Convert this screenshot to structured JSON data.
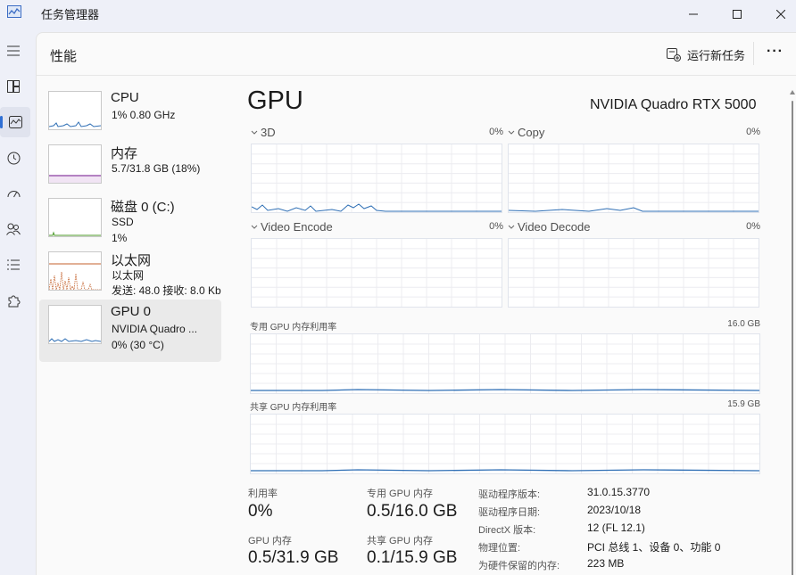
{
  "window": {
    "title": "任务管理器"
  },
  "header": {
    "page_title": "性能",
    "run_task_label": "运行新任务",
    "more_label": "···"
  },
  "resources": [
    {
      "name": "CPU",
      "line1": "1% 0.80 GHz",
      "line2": ""
    },
    {
      "name": "内存",
      "line1": "5.7/31.8 GB (18%)",
      "line2": ""
    },
    {
      "name": "磁盘 0 (C:)",
      "line1": "SSD",
      "line2": "1%"
    },
    {
      "name": "以太网",
      "line1": "以太网",
      "line2": "发送: 48.0  接收: 8.0 Kb"
    },
    {
      "name": "GPU 0",
      "line1": "NVIDIA Quadro ...",
      "line2": "0% (30 °C)"
    }
  ],
  "gpu": {
    "heading": "GPU",
    "model": "NVIDIA Quadro RTX 5000",
    "engines": [
      {
        "label": "3D",
        "pct": "0%"
      },
      {
        "label": "Copy",
        "pct": "0%"
      },
      {
        "label": "Video Encode",
        "pct": "0%"
      },
      {
        "label": "Video Decode",
        "pct": "0%"
      }
    ],
    "dedicated_label": "专用 GPU 内存利用率",
    "dedicated_max": "16.0 GB",
    "shared_label": "共享 GPU 内存利用率",
    "shared_max": "15.9 GB",
    "stats": {
      "utilization_label": "利用率",
      "utilization_value": "0%",
      "dedicated_mem_label": "专用 GPU 内存",
      "dedicated_mem_value": "0.5/16.0 GB",
      "gpu_mem_label": "GPU 内存",
      "gpu_mem_value": "0.5/31.9 GB",
      "shared_mem_label": "共享 GPU 内存",
      "shared_mem_value": "0.1/15.9 GB"
    },
    "info": [
      {
        "key": "驱动程序版本:",
        "value": "31.0.15.3770"
      },
      {
        "key": "驱动程序日期:",
        "value": "2023/10/18"
      },
      {
        "key": "DirectX 版本:",
        "value": "12 (FL 12.1)"
      },
      {
        "key": "物理位置:",
        "value": "PCI 总线 1、设备 0、功能 0"
      },
      {
        "key": "为硬件保留的内存:",
        "value": "223 MB"
      }
    ]
  },
  "colors": {
    "gpu_line": "#2f6fb5",
    "memory_line": "#8b3fa0",
    "network_line": "#c4622d",
    "disk_line": "#4c9a2a",
    "accent": "#2f6fd4"
  }
}
